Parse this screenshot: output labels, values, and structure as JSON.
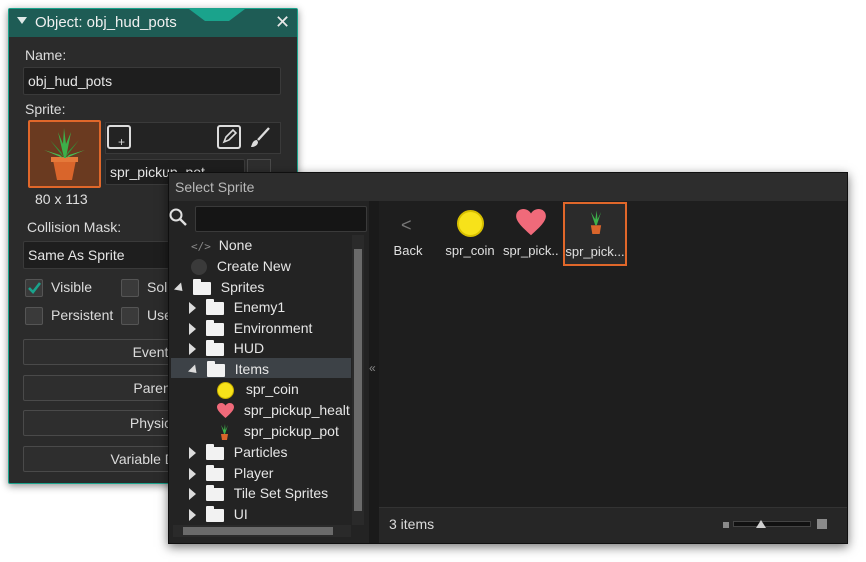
{
  "object_window": {
    "title": "Object: obj_hud_pots",
    "name_label": "Name:",
    "name_value": "obj_hud_pots",
    "sprite_label": "Sprite:",
    "sprite_size": "80 x 113",
    "sprite_name": "spr_pickup_pot",
    "collision_mask_label": "Collision Mask:",
    "collision_mask_value": "Same As Sprite",
    "visible_label": "Visible",
    "solid_label": "Sol",
    "persistent_label": "Persistent",
    "uses_physics_label": "Use",
    "buttons": [
      "Events",
      "Parent",
      "Physics",
      "Variable Defin"
    ]
  },
  "select_sprite": {
    "title": "Select Sprite",
    "search_value": "",
    "tree": {
      "none": "None",
      "create_new": "Create New",
      "sprites": "Sprites",
      "folders": [
        "Enemy1",
        "Environment",
        "HUD"
      ],
      "items_folder": "Items",
      "items": [
        "spr_coin",
        "spr_pickup_healt",
        "spr_pickup_pot"
      ],
      "folders_after": [
        "Particles",
        "Player",
        "Tile Set Sprites",
        "UI"
      ]
    },
    "grid": [
      {
        "label": "Back",
        "icon": "back-arrow-icon"
      },
      {
        "label": "spr_coin",
        "icon": "coin-icon"
      },
      {
        "label": "spr_pick...",
        "icon": "heart-icon"
      },
      {
        "label": "spr_pick...",
        "icon": "potted-plant-icon",
        "selected": true
      }
    ],
    "status": "3 items",
    "colors": {
      "accent_teal": "#1aa38c",
      "selection_orange": "#e0672a",
      "coin_yellow": "#f7e21a",
      "heart_pink": "#f06a7a"
    }
  }
}
